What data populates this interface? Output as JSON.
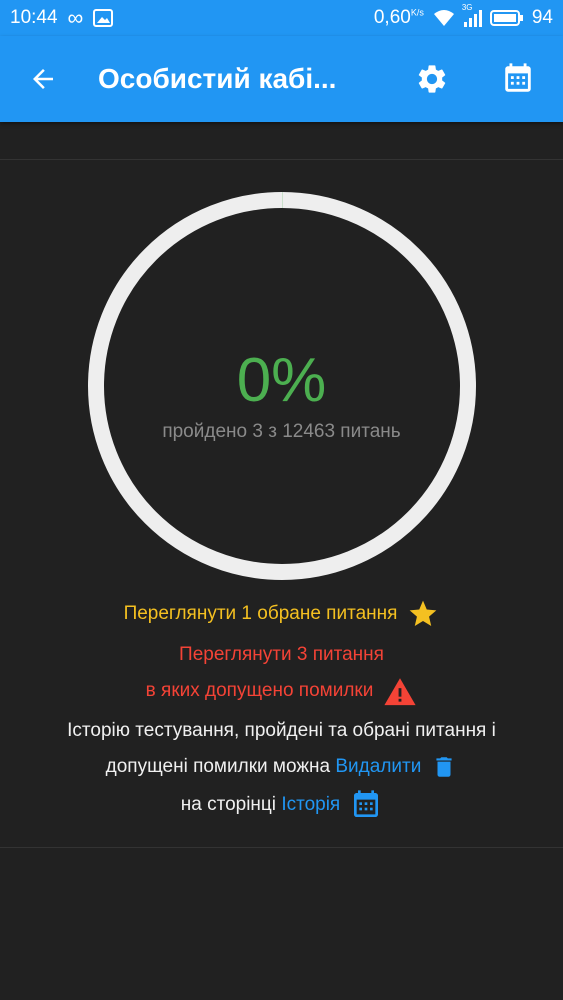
{
  "status_bar": {
    "time": "10:44",
    "speed": "0,60",
    "speed_unit": "K/s",
    "network": "3G",
    "battery": "94"
  },
  "app_bar": {
    "title": "Особистий кабі...",
    "back_icon": "arrow-left-icon",
    "settings_icon": "gear-icon",
    "calendar_icon": "calendar-icon"
  },
  "progress": {
    "percent_label": "0%",
    "fraction": 0.0002,
    "passed": "пройдено 3 з 12463 питань"
  },
  "links": {
    "favorites": "Переглянути 1 обране питання",
    "mistakes_line1": "Переглянути 3 питання",
    "mistakes_line2": "в яких допущено помилки"
  },
  "info": {
    "line1": "Історію тестування, пройдені та обрані питання і",
    "line2": "допущені помилки можна",
    "delete_link": "Видалити",
    "line3": "на сторінці",
    "history_link": "Історія"
  },
  "colors": {
    "primary": "#2196f3",
    "success": "#4caf50",
    "favorite": "#f4c021",
    "error": "#f44336",
    "background": "#212121"
  }
}
